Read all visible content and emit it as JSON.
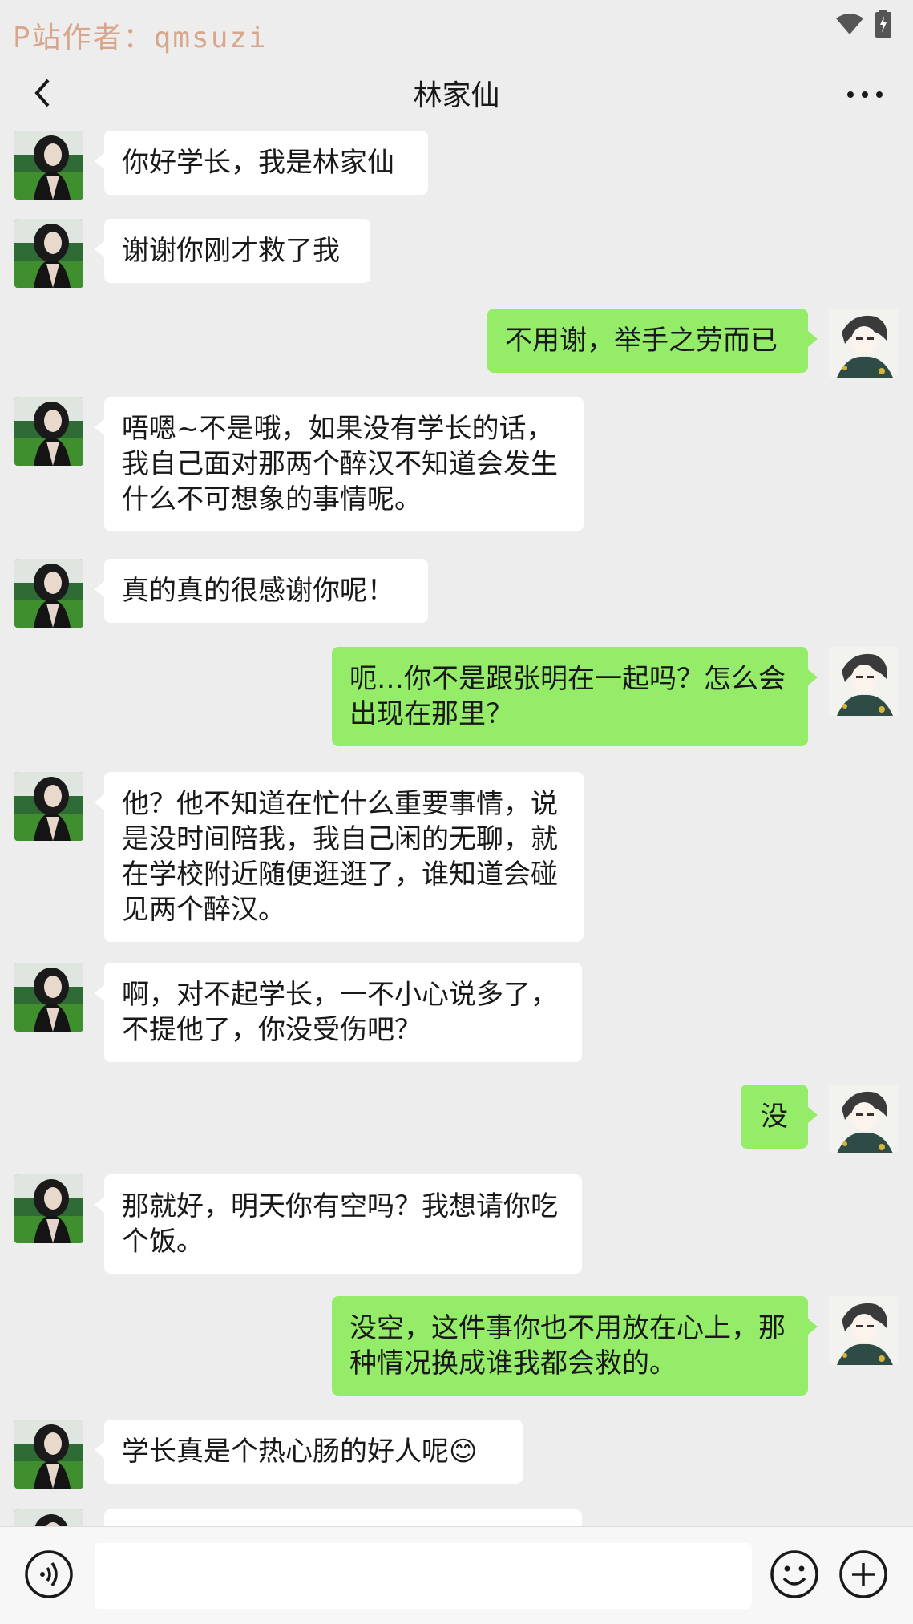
{
  "status": {
    "watermark": "P站作者：qmsuzi"
  },
  "navbar": {
    "title": "林家仙",
    "back_icon": "chevron-left-icon",
    "more_icon": "more-dots-icon"
  },
  "messages": [
    {
      "side": "in",
      "text": "你好学长，我是林家仙"
    },
    {
      "side": "in",
      "text": "谢谢你刚才救了我"
    },
    {
      "side": "out",
      "text": "不用谢，举手之劳而已"
    },
    {
      "side": "in",
      "text": "唔嗯~不是哦，如果没有学长的话，我自己面对那两个醉汉不知道会发生什么不可想象的事情呢。"
    },
    {
      "side": "in",
      "text": "真的真的很感谢你呢！"
    },
    {
      "side": "out",
      "text": "呃…你不是跟张明在一起吗？怎么会出现在那里？"
    },
    {
      "side": "in",
      "text": "他？他不知道在忙什么重要事情，说是没时间陪我，我自己闲的无聊，就在学校附近随便逛逛了，谁知道会碰见两个醉汉。"
    },
    {
      "side": "in",
      "text": "啊，对不起学长，一不小心说多了，不提他了，你没受伤吧？"
    },
    {
      "side": "out",
      "text": "没"
    },
    {
      "side": "in",
      "text": "那就好，明天你有空吗？我想请你吃个饭。"
    },
    {
      "side": "out",
      "text": "没空，这件事你也不用放在心上，那种情况换成谁我都会救的。"
    },
    {
      "side": "in",
      "text": "学长真是个热心肠的好人呢😊"
    }
  ],
  "input": {
    "value": "",
    "voice_icon": "voice-icon",
    "emoji_icon": "emoji-icon",
    "add_icon": "plus-icon"
  },
  "colors": {
    "background": "#ededed",
    "outgoing_bubble": "#95ec69",
    "incoming_bubble": "#ffffff",
    "watermark": "#d9a68c"
  }
}
